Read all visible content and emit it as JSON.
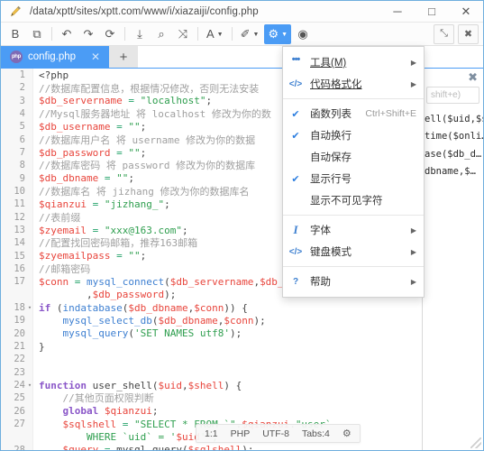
{
  "window": {
    "title": "/data/xptt/sites/xptt.com/www/i/xiazaiji/config.php",
    "app_icon": "pencil-icon",
    "minimize": "─",
    "maximize": "□",
    "close": "✕",
    "accent_color": "#4b9cf5",
    "border_color": "#6faede"
  },
  "toolbar": {
    "items": [
      {
        "name": "save-button",
        "glyph": "὚B",
        "caret": false,
        "active": false
      },
      {
        "name": "save-as-button",
        "glyph": "⧉",
        "caret": false,
        "active": false
      },
      {
        "name": "sep1",
        "glyph": "|",
        "sep": true
      },
      {
        "name": "undo-button",
        "glyph": "↶",
        "caret": false,
        "active": false
      },
      {
        "name": "redo-button",
        "glyph": "↷",
        "caret": false,
        "active": false
      },
      {
        "name": "refresh-button",
        "glyph": "⟳",
        "caret": false,
        "active": false
      },
      {
        "name": "sep2",
        "glyph": "|",
        "sep": true
      },
      {
        "name": "pin-button",
        "glyph": "⤓",
        "caret": false,
        "active": false
      },
      {
        "name": "search-button",
        "glyph": "⌕",
        "caret": false,
        "active": false
      },
      {
        "name": "replace-button",
        "glyph": "⤨",
        "caret": false,
        "active": false
      },
      {
        "name": "sep3",
        "glyph": "|",
        "sep": true
      },
      {
        "name": "font-button",
        "glyph": "A",
        "caret": true,
        "active": false
      },
      {
        "name": "sep4",
        "glyph": "|",
        "sep": true
      },
      {
        "name": "theme-button",
        "glyph": "✐",
        "caret": true,
        "active": false
      },
      {
        "name": "settings-button",
        "glyph": "⚙",
        "caret": true,
        "active": true
      },
      {
        "name": "preview-button",
        "glyph": "◉",
        "caret": false,
        "active": false
      }
    ],
    "right_items": [
      {
        "name": "fullscreen-button",
        "glyph": "⤡"
      },
      {
        "name": "close-editor-button",
        "glyph": "✖"
      }
    ]
  },
  "tabs": {
    "open": [
      {
        "icon_label": "php",
        "label": "config.php",
        "close_glyph": "✕",
        "active": true
      }
    ],
    "add_glyph": "+"
  },
  "menu": {
    "items": [
      {
        "kind": "item",
        "name": "menu-item-tools",
        "icon": "dots-icon",
        "icon_glyph": "•••",
        "icon_style": "dots",
        "label": "工具(M)",
        "mnemonic": true,
        "accel": "",
        "arrow": true,
        "checked": false
      },
      {
        "kind": "item",
        "name": "menu-item-code-format",
        "icon": "code-icon",
        "icon_glyph": "</>",
        "icon_style": "",
        "label": "代码格式化",
        "mnemonic": true,
        "accel": "",
        "arrow": true,
        "checked": false
      },
      {
        "kind": "sep",
        "name": "menu-separator-1"
      },
      {
        "kind": "item",
        "name": "menu-item-function-list",
        "icon": "",
        "icon_glyph": "",
        "icon_style": "",
        "label": "函数列表",
        "mnemonic": false,
        "accel": "Ctrl+Shift+E",
        "arrow": false,
        "checked": true
      },
      {
        "kind": "item",
        "name": "menu-item-auto-wrap",
        "icon": "",
        "icon_glyph": "",
        "icon_style": "",
        "label": "自动换行",
        "mnemonic": false,
        "accel": "",
        "arrow": false,
        "checked": true
      },
      {
        "kind": "item",
        "name": "menu-item-auto-save",
        "icon": "",
        "icon_glyph": "",
        "icon_style": "",
        "label": "自动保存",
        "mnemonic": false,
        "accel": "",
        "arrow": false,
        "checked": false
      },
      {
        "kind": "item",
        "name": "menu-item-show-line-numbers",
        "icon": "",
        "icon_glyph": "",
        "icon_style": "",
        "label": "显示行号",
        "mnemonic": false,
        "accel": "",
        "arrow": false,
        "checked": true
      },
      {
        "kind": "item",
        "name": "menu-item-show-invisibles",
        "icon": "",
        "icon_glyph": "",
        "icon_style": "",
        "label": "显示不可见字符",
        "mnemonic": false,
        "accel": "",
        "arrow": false,
        "checked": false
      },
      {
        "kind": "sep",
        "name": "menu-separator-2"
      },
      {
        "kind": "item",
        "name": "menu-item-font",
        "icon": "italic-icon",
        "icon_glyph": "I",
        "icon_style": "italic",
        "label": "字体",
        "mnemonic": false,
        "accel": "",
        "arrow": true,
        "checked": false
      },
      {
        "kind": "item",
        "name": "menu-item-keyboard-mode",
        "icon": "code-icon",
        "icon_glyph": "</>",
        "icon_style": "",
        "label": "键盘模式",
        "mnemonic": false,
        "accel": "",
        "arrow": true,
        "checked": false
      },
      {
        "kind": "sep",
        "name": "menu-separator-3"
      },
      {
        "kind": "item",
        "name": "menu-item-help",
        "icon": "question-icon",
        "icon_glyph": "?",
        "icon_style": "",
        "label": "帮助",
        "mnemonic": false,
        "accel": "",
        "arrow": true,
        "checked": false
      }
    ],
    "check_glyph": "✔",
    "arrow_glyph": "▶"
  },
  "function_panel": {
    "close_glyph": "✖",
    "search_placeholder": "shift+e)",
    "items": [
      {
        "label": "ell($uid,$s…"
      },
      {
        "label": "time($onli…"
      },
      {
        "label": "ase($db_d…"
      },
      {
        "label": "dbname,$…"
      }
    ]
  },
  "statusbar": {
    "cursor": "1:1",
    "language": "PHP",
    "encoding": "UTF-8",
    "tabs": "Tabs:4",
    "gear_glyph": "⚙"
  },
  "editor": {
    "lines": [
      {
        "n": "1",
        "fold": "",
        "tokens": [
          {
            "t": "<?php",
            "c": "c-tag"
          }
        ]
      },
      {
        "n": "2",
        "fold": "",
        "tokens": [
          {
            "t": "//数据库配置信息，根据情况修改，否则无法安装",
            "c": "c-cmt"
          }
        ]
      },
      {
        "n": "3",
        "fold": "",
        "tokens": [
          {
            "t": "$db_servername",
            "c": "c-var"
          },
          {
            "t": " ",
            "c": "c-pln"
          },
          {
            "t": "=",
            "c": "c-op"
          },
          {
            "t": " ",
            "c": "c-pln"
          },
          {
            "t": "\"localhost\"",
            "c": "c-str"
          },
          {
            "t": ";",
            "c": "c-pln"
          }
        ]
      },
      {
        "n": "4",
        "fold": "",
        "tokens": [
          {
            "t": "//Mysql服务器地址 将 localhost 修改为你的数",
            "c": "c-cmt"
          }
        ]
      },
      {
        "n": "5",
        "fold": "",
        "tokens": [
          {
            "t": "$db_username",
            "c": "c-var"
          },
          {
            "t": " ",
            "c": "c-pln"
          },
          {
            "t": "=",
            "c": "c-op"
          },
          {
            "t": " ",
            "c": "c-pln"
          },
          {
            "t": "\"\"",
            "c": "c-str"
          },
          {
            "t": ";",
            "c": "c-pln"
          }
        ]
      },
      {
        "n": "6",
        "fold": "",
        "tokens": [
          {
            "t": "//数据库用户名 将 username 修改为你的数据",
            "c": "c-cmt"
          }
        ]
      },
      {
        "n": "7",
        "fold": "",
        "tokens": [
          {
            "t": "$db_password",
            "c": "c-var"
          },
          {
            "t": " ",
            "c": "c-pln"
          },
          {
            "t": "=",
            "c": "c-op"
          },
          {
            "t": " ",
            "c": "c-pln"
          },
          {
            "t": "\"\"",
            "c": "c-str"
          },
          {
            "t": ";",
            "c": "c-pln"
          }
        ]
      },
      {
        "n": "8",
        "fold": "",
        "tokens": [
          {
            "t": "//数据库密码 将 password 修改为你的数据库",
            "c": "c-cmt"
          }
        ]
      },
      {
        "n": "9",
        "fold": "",
        "tokens": [
          {
            "t": "$db_dbname",
            "c": "c-var"
          },
          {
            "t": " ",
            "c": "c-pln"
          },
          {
            "t": "=",
            "c": "c-op"
          },
          {
            "t": " ",
            "c": "c-pln"
          },
          {
            "t": "\"\"",
            "c": "c-str"
          },
          {
            "t": ";",
            "c": "c-pln"
          }
        ]
      },
      {
        "n": "10",
        "fold": "",
        "tokens": [
          {
            "t": "//数据库名 将 jizhang 修改为你的数据库名",
            "c": "c-cmt"
          }
        ]
      },
      {
        "n": "11",
        "fold": "",
        "tokens": [
          {
            "t": "$qianzui",
            "c": "c-var"
          },
          {
            "t": " ",
            "c": "c-pln"
          },
          {
            "t": "=",
            "c": "c-op"
          },
          {
            "t": " ",
            "c": "c-pln"
          },
          {
            "t": "\"jizhang_\"",
            "c": "c-str"
          },
          {
            "t": ";",
            "c": "c-pln"
          }
        ]
      },
      {
        "n": "12",
        "fold": "",
        "tokens": [
          {
            "t": "//表前缀",
            "c": "c-cmt"
          }
        ]
      },
      {
        "n": "13",
        "fold": "",
        "tokens": [
          {
            "t": "$zyemail",
            "c": "c-var"
          },
          {
            "t": " ",
            "c": "c-pln"
          },
          {
            "t": "=",
            "c": "c-op"
          },
          {
            "t": " ",
            "c": "c-pln"
          },
          {
            "t": "\"xxx@163.com\"",
            "c": "c-str"
          },
          {
            "t": ";",
            "c": "c-pln"
          }
        ]
      },
      {
        "n": "14",
        "fold": "",
        "tokens": [
          {
            "t": "//配置找回密码邮箱，推荐163邮箱",
            "c": "c-cmt"
          }
        ]
      },
      {
        "n": "15",
        "fold": "",
        "tokens": [
          {
            "t": "$zyemailpass",
            "c": "c-var"
          },
          {
            "t": " ",
            "c": "c-pln"
          },
          {
            "t": "=",
            "c": "c-op"
          },
          {
            "t": " ",
            "c": "c-pln"
          },
          {
            "t": "\"\"",
            "c": "c-str"
          },
          {
            "t": ";",
            "c": "c-pln"
          }
        ]
      },
      {
        "n": "16",
        "fold": "",
        "tokens": [
          {
            "t": "//邮箱密码",
            "c": "c-cmt"
          }
        ]
      },
      {
        "n": "17",
        "fold": "",
        "tokens": [
          {
            "t": "$conn",
            "c": "c-var"
          },
          {
            "t": " ",
            "c": "c-pln"
          },
          {
            "t": "=",
            "c": "c-op"
          },
          {
            "t": " ",
            "c": "c-pln"
          },
          {
            "t": "mysql_connect",
            "c": "c-fn"
          },
          {
            "t": "(",
            "c": "c-pln"
          },
          {
            "t": "$db_servername",
            "c": "c-var"
          },
          {
            "t": ",",
            "c": "c-pln"
          },
          {
            "t": "$db_username",
            "c": "c-var"
          }
        ]
      },
      {
        "n": "",
        "fold": "",
        "tokens": [
          {
            "t": "        ,",
            "c": "c-pln"
          },
          {
            "t": "$db_password",
            "c": "c-var"
          },
          {
            "t": ");",
            "c": "c-pln"
          }
        ]
      },
      {
        "n": "18",
        "fold": "▾",
        "tokens": [
          {
            "t": "if",
            "c": "c-kw"
          },
          {
            "t": " (",
            "c": "c-pln"
          },
          {
            "t": "indatabase",
            "c": "c-fn"
          },
          {
            "t": "(",
            "c": "c-pln"
          },
          {
            "t": "$db_dbname",
            "c": "c-var"
          },
          {
            "t": ",",
            "c": "c-pln"
          },
          {
            "t": "$conn",
            "c": "c-var"
          },
          {
            "t": ")) {",
            "c": "c-pln"
          }
        ]
      },
      {
        "n": "19",
        "fold": "",
        "tokens": [
          {
            "t": "    ",
            "c": "c-pln"
          },
          {
            "t": "mysql_select_db",
            "c": "c-fn"
          },
          {
            "t": "(",
            "c": "c-pln"
          },
          {
            "t": "$db_dbname",
            "c": "c-var"
          },
          {
            "t": ",",
            "c": "c-pln"
          },
          {
            "t": "$conn",
            "c": "c-var"
          },
          {
            "t": ");",
            "c": "c-pln"
          }
        ]
      },
      {
        "n": "20",
        "fold": "",
        "tokens": [
          {
            "t": "    ",
            "c": "c-pln"
          },
          {
            "t": "mysql_query",
            "c": "c-fn"
          },
          {
            "t": "(",
            "c": "c-pln"
          },
          {
            "t": "'SET NAMES utf8'",
            "c": "c-str"
          },
          {
            "t": ");",
            "c": "c-pln"
          }
        ]
      },
      {
        "n": "21",
        "fold": "",
        "tokens": [
          {
            "t": "}",
            "c": "c-pln"
          }
        ]
      },
      {
        "n": "22",
        "fold": "",
        "tokens": [
          {
            "t": "",
            "c": "c-pln"
          }
        ]
      },
      {
        "n": "23",
        "fold": "",
        "tokens": [
          {
            "t": "",
            "c": "c-pln"
          }
        ]
      },
      {
        "n": "24",
        "fold": "▾",
        "tokens": [
          {
            "t": "function",
            "c": "c-kw"
          },
          {
            "t": " ",
            "c": "c-pln"
          },
          {
            "t": "user_shell",
            "c": "c-pln"
          },
          {
            "t": "(",
            "c": "c-pln"
          },
          {
            "t": "$uid",
            "c": "c-var"
          },
          {
            "t": ",",
            "c": "c-pln"
          },
          {
            "t": "$shell",
            "c": "c-var"
          },
          {
            "t": ") {",
            "c": "c-pln"
          }
        ]
      },
      {
        "n": "25",
        "fold": "",
        "tokens": [
          {
            "t": "    //其他页面权限判断",
            "c": "c-cmt"
          }
        ]
      },
      {
        "n": "26",
        "fold": "",
        "tokens": [
          {
            "t": "    ",
            "c": "c-pln"
          },
          {
            "t": "global",
            "c": "c-kw"
          },
          {
            "t": " ",
            "c": "c-pln"
          },
          {
            "t": "$qianzui",
            "c": "c-var"
          },
          {
            "t": ";",
            "c": "c-pln"
          }
        ]
      },
      {
        "n": "27",
        "fold": "",
        "tokens": [
          {
            "t": "    ",
            "c": "c-pln"
          },
          {
            "t": "$sqlshell",
            "c": "c-var"
          },
          {
            "t": " ",
            "c": "c-pln"
          },
          {
            "t": "=",
            "c": "c-op"
          },
          {
            "t": " ",
            "c": "c-pln"
          },
          {
            "t": "\"SELECT * FROM `\"",
            "c": "c-str"
          },
          {
            "t": ".",
            "c": "c-pln"
          },
          {
            "t": "$qianzui",
            "c": "c-var"
          },
          {
            "t": ".",
            "c": "c-pln"
          },
          {
            "t": "\"user`",
            "c": "c-str"
          }
        ]
      },
      {
        "n": "",
        "fold": "",
        "tokens": [
          {
            "t": "        WHERE `uid` = '",
            "c": "c-str"
          },
          {
            "t": "$uid",
            "c": "c-var"
          },
          {
            "t": "'\";",
            "c": "c-str"
          }
        ]
      },
      {
        "n": "28",
        "fold": "",
        "tokens": [
          {
            "t": "    ",
            "c": "c-pln"
          },
          {
            "t": "$query",
            "c": "c-var"
          },
          {
            "t": " ",
            "c": "c-pln"
          },
          {
            "t": "=",
            "c": "c-op"
          },
          {
            "t": " ",
            "c": "c-pln"
          },
          {
            "t": "mysql_query",
            "c": "c-pln"
          },
          {
            "t": "(",
            "c": "c-pln"
          },
          {
            "t": "$sqlshell",
            "c": "c-var"
          },
          {
            "t": ");",
            "c": "c-pln"
          }
        ]
      }
    ]
  }
}
